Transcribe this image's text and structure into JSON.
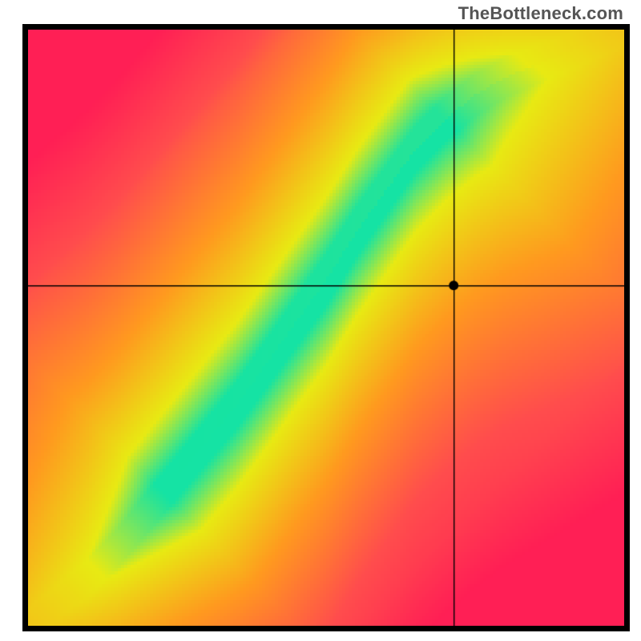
{
  "watermark": "TheBottleneck.com",
  "chart_data": {
    "type": "heatmap",
    "title": "",
    "xlabel": "",
    "ylabel": "",
    "xlim": [
      0,
      100
    ],
    "ylim": [
      0,
      100
    ],
    "grid_size": 186,
    "marker": {
      "x_frac": 0.714,
      "y_frac": 0.571
    },
    "crosshair": {
      "x_frac": 0.714,
      "y_frac": 0.571
    },
    "ridge": {
      "description": "green band of near-zero bottleneck; deviation → yellow → orange → red",
      "points_xy_frac": [
        [
          0.0,
          0.0
        ],
        [
          0.05,
          0.04
        ],
        [
          0.1,
          0.08
        ],
        [
          0.15,
          0.13
        ],
        [
          0.2,
          0.19
        ],
        [
          0.25,
          0.25
        ],
        [
          0.3,
          0.31
        ],
        [
          0.35,
          0.37
        ],
        [
          0.4,
          0.44
        ],
        [
          0.45,
          0.51
        ],
        [
          0.5,
          0.58
        ],
        [
          0.55,
          0.66
        ],
        [
          0.6,
          0.73
        ],
        [
          0.65,
          0.8
        ],
        [
          0.7,
          0.85
        ],
        [
          0.75,
          0.89
        ],
        [
          0.8,
          0.92
        ],
        [
          0.85,
          0.94
        ],
        [
          0.9,
          0.96
        ],
        [
          0.95,
          0.98
        ],
        [
          1.0,
          1.0
        ]
      ]
    },
    "colors": {
      "best": "#15e3a4",
      "good": "#e8ea13",
      "warn": "#ff9a1f",
      "bad": "#ff4d4d",
      "worst": "#ff1f55"
    }
  }
}
